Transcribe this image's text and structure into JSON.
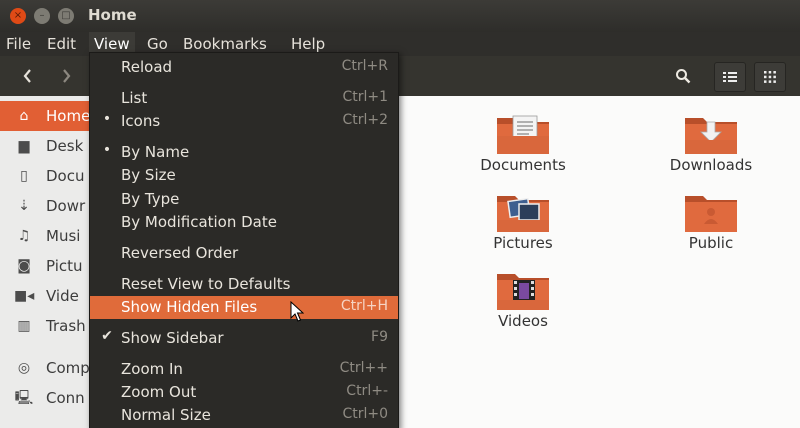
{
  "window": {
    "title": "Home",
    "close_glyph": "×",
    "min_glyph": "–",
    "max_glyph": "□"
  },
  "menubar": {
    "items": [
      "File",
      "Edit",
      "View",
      "Go",
      "Bookmarks",
      "Help"
    ],
    "active": "View"
  },
  "toolbar": {
    "back_icon": "chevron-left-icon",
    "forward_icon": "chevron-right-icon",
    "search_icon": "search-icon",
    "list_view_icon": "list-view-icon",
    "grid_view_icon": "grid-view-icon"
  },
  "sidebar": {
    "items": [
      {
        "label": "Home",
        "icon": "home-icon",
        "selected": true
      },
      {
        "label": "Desk",
        "icon": "folder-icon",
        "selected": false
      },
      {
        "label": "Docu",
        "icon": "document-icon",
        "selected": false
      },
      {
        "label": "Dowr",
        "icon": "download-icon",
        "selected": false
      },
      {
        "label": "Musi",
        "icon": "music-icon",
        "selected": false
      },
      {
        "label": "Pictu",
        "icon": "camera-icon",
        "selected": false
      },
      {
        "label": "Vide",
        "icon": "video-icon",
        "selected": false
      },
      {
        "label": "Trash",
        "icon": "trash-icon",
        "selected": false
      },
      {
        "label": "Comp",
        "icon": "computer-icon",
        "selected": false
      },
      {
        "label": "Conn",
        "icon": "network-icon",
        "selected": false
      }
    ]
  },
  "folders": [
    {
      "label": "Documents",
      "emblem": "document"
    },
    {
      "label": "Downloads",
      "emblem": "download"
    },
    {
      "label": "Pictures",
      "emblem": "picture"
    },
    {
      "label": "Public",
      "emblem": "person"
    },
    {
      "label": "Videos",
      "emblem": "film"
    }
  ],
  "view_menu": {
    "items": [
      {
        "label": "Reload",
        "accel": "Ctrl+R",
        "mark": ""
      },
      {
        "label": "List",
        "accel": "Ctrl+1",
        "mark": ""
      },
      {
        "label": "Icons",
        "accel": "Ctrl+2",
        "mark": "•"
      },
      {
        "label": "By Name",
        "accel": "",
        "mark": "•"
      },
      {
        "label": "By Size",
        "accel": "",
        "mark": ""
      },
      {
        "label": "By Type",
        "accel": "",
        "mark": ""
      },
      {
        "label": "By Modification Date",
        "accel": "",
        "mark": ""
      },
      {
        "label": "Reversed Order",
        "accel": "",
        "mark": ""
      },
      {
        "label": "Reset View to Defaults",
        "accel": "",
        "mark": ""
      },
      {
        "label": "Show Hidden Files",
        "accel": "Ctrl+H",
        "mark": "",
        "highlighted": true
      },
      {
        "label": "Show Sidebar",
        "accel": "F9",
        "mark": "✔"
      },
      {
        "label": "Zoom In",
        "accel": "Ctrl++",
        "mark": ""
      },
      {
        "label": "Zoom Out",
        "accel": "Ctrl+-",
        "mark": ""
      },
      {
        "label": "Normal Size",
        "accel": "Ctrl+0",
        "mark": ""
      }
    ]
  },
  "colors": {
    "accent": "#e15f34",
    "folder": "#d9673c",
    "menu_bg": "#2b2a27"
  }
}
